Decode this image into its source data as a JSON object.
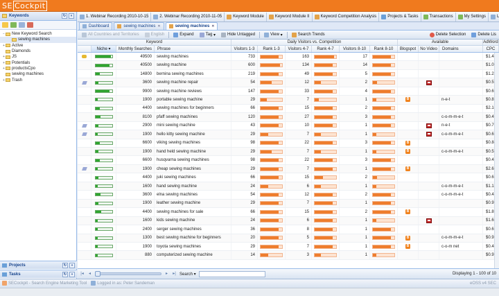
{
  "app": {
    "logo_text": "SE",
    "logo_box": "Cockpit",
    "accent": "#f07a1e"
  },
  "bookmarks": [
    "1. Webinar Recording 2010-10-15",
    "2. Webinar Recording 2010-11-05",
    "Keyword Module",
    "Keyword Module II",
    "Keyword Competition Analysis",
    "Projects & Tasks",
    "Transactions",
    "My Settings",
    "Logo"
  ],
  "left": {
    "title": "Keywords",
    "tree": [
      {
        "label": "New Keyword Search",
        "level": 0,
        "expander": "−"
      },
      {
        "label": "sewing machines",
        "level": 1,
        "selected": true
      },
      {
        "label": "Active",
        "level": 0,
        "expander": "+"
      },
      {
        "label": "Diamonds",
        "level": 0,
        "expander": ""
      },
      {
        "label": "JS",
        "level": 0,
        "expander": "+"
      },
      {
        "label": "Potentials",
        "level": 0,
        "expander": "+"
      },
      {
        "label": "productsCpo",
        "level": 0,
        "expander": "+"
      },
      {
        "label": "sewing machines",
        "level": 0,
        "expander": ""
      },
      {
        "label": "Trash",
        "level": 0,
        "expander": "+"
      }
    ],
    "projects_label": "Projects",
    "tasks_label": "Tasks"
  },
  "tabs": [
    {
      "label": "Dashboard",
      "active": false
    },
    {
      "label": "sewing machines",
      "active": false
    },
    {
      "label": "sewing machines",
      "active": true
    }
  ],
  "toolbar": {
    "all_countries": "All Countries and Territories",
    "english": "English",
    "expand": "Expand",
    "tag": "Tag",
    "hide_untagged": "Hide Untagged",
    "view": "View",
    "search_trends": "Search Trends",
    "delete_selection": "Delete Selection",
    "delete_list": "Delete Lis"
  },
  "headers": {
    "group_keyword": "Keyword",
    "group_daily": "Daily Visitors vs. Competition",
    "group_available": "Available",
    "group_adword": "AdWord",
    "niche": "Niche",
    "monthly": "Monthly Searches",
    "phrase": "Phrase",
    "v13": "Visitors 1-3",
    "r13": "Rank 1-3",
    "v47": "Visitors 4-7",
    "r47": "Rank 4-7",
    "v810": "Visitors 8-10",
    "r810": "Rank 8-10",
    "blogspot": "Blogspot",
    "novideo": "No Video",
    "domains": "Domains",
    "cpc": "CPC"
  },
  "rows": [
    {
      "icon": "key",
      "niche": 0.95,
      "searches": "49500",
      "phrase": "sewing machines",
      "v13": "733",
      "r13": 0.85,
      "v47": "163",
      "r47": 0.9,
      "v810": "17",
      "r810": 0.85,
      "blog": false,
      "video": false,
      "domain": "",
      "cpc": "$1.48"
    },
    {
      "icon": "",
      "niche": 0.85,
      "searches": "40500",
      "phrase": "sewing machine",
      "v13": "600",
      "r13": 0.9,
      "v47": "134",
      "r47": 0.85,
      "v810": "14",
      "r810": 0.85,
      "blog": false,
      "video": false,
      "domain": "",
      "cpc": "$1.06"
    },
    {
      "icon": "",
      "niche": 0.25,
      "searches": "14800",
      "phrase": "bernina sewing machines",
      "v13": "219",
      "r13": 0.85,
      "v47": "49",
      "r47": 0.85,
      "v810": "5",
      "r810": 0.85,
      "blog": false,
      "video": false,
      "domain": "",
      "cpc": "$1.22"
    },
    {
      "icon": "tag",
      "niche": 0.2,
      "searches": "3600",
      "phrase": "sewing machine repair",
      "v13": "54",
      "r13": 0.5,
      "v47": "12",
      "r47": 0.3,
      "v810": "2",
      "r810": 0.2,
      "blog": false,
      "video": true,
      "domain": "",
      "cpc": "$0.57"
    },
    {
      "icon": "",
      "niche": 0.85,
      "searches": "9900",
      "phrase": "sewing machine reviews",
      "v13": "147",
      "r13": 0.85,
      "v47": "33",
      "r47": 0.85,
      "v810": "4",
      "r810": 0.85,
      "blog": false,
      "video": false,
      "domain": "",
      "cpc": "$0.67"
    },
    {
      "icon": "",
      "niche": 0.15,
      "searches": "1900",
      "phrase": "portable sewing machine",
      "v13": "29",
      "r13": 0.3,
      "v47": "7",
      "r47": 0.2,
      "v810": "1",
      "r810": 0.15,
      "blog": true,
      "video": false,
      "domain": "n-e-t",
      "cpc": "$0.81"
    },
    {
      "icon": "",
      "niche": 0.25,
      "searches": "4400",
      "phrase": "sewing machines for beginners",
      "v13": "66",
      "r13": 0.85,
      "v47": "15",
      "r47": 0.85,
      "v810": "2",
      "r810": 0.85,
      "blog": false,
      "video": false,
      "domain": "",
      "cpc": "$2.10"
    },
    {
      "icon": "",
      "niche": 0.3,
      "searches": "8100",
      "phrase": "pfaff sewing machines",
      "v13": "120",
      "r13": 0.85,
      "v47": "27",
      "r47": 0.85,
      "v810": "3",
      "r810": 0.85,
      "blog": false,
      "video": false,
      "domain": "c-o-m-m-e-t",
      "cpc": "$0.49"
    },
    {
      "icon": "tag",
      "niche": 0.2,
      "searches": "2900",
      "phrase": "mini sewing machine",
      "v13": "43",
      "r13": 0.85,
      "v47": "10",
      "r47": 0.85,
      "v810": "1",
      "r810": 0.85,
      "blog": false,
      "video": true,
      "domain": "n-e-t",
      "cpc": "$0.70"
    },
    {
      "icon": "tag",
      "niche": 0.15,
      "searches": "1900",
      "phrase": "hello kitty sewing machine",
      "v13": "29",
      "r13": 0.35,
      "v47": "7",
      "r47": 0.3,
      "v810": "1",
      "r810": 0.15,
      "blog": false,
      "video": true,
      "domain": "c-o-m-m-e-t",
      "cpc": "$0.67"
    },
    {
      "icon": "",
      "niche": 0.25,
      "searches": "6600",
      "phrase": "viking sewing machines",
      "v13": "98",
      "r13": 0.85,
      "v47": "22",
      "r47": 0.85,
      "v810": "3",
      "r810": 0.85,
      "blog": true,
      "video": false,
      "domain": "",
      "cpc": "$0.84"
    },
    {
      "icon": "",
      "niche": 0.2,
      "searches": "1900",
      "phrase": "hand held sewing machine",
      "v13": "29",
      "r13": 0.5,
      "v47": "7",
      "r47": 0.3,
      "v810": "1",
      "r810": 0.15,
      "blog": true,
      "video": false,
      "domain": "c-o-m-m-e-t",
      "cpc": "$0.53"
    },
    {
      "icon": "",
      "niche": 0.25,
      "searches": "6600",
      "phrase": "husqvarna sewing machines",
      "v13": "98",
      "r13": 0.85,
      "v47": "22",
      "r47": 0.85,
      "v810": "3",
      "r810": 0.85,
      "blog": false,
      "video": false,
      "domain": "",
      "cpc": "$0.45"
    },
    {
      "icon": "tag",
      "niche": 0.15,
      "searches": "1900",
      "phrase": "cheap sewing machines",
      "v13": "29",
      "r13": 0.85,
      "v47": "7",
      "r47": 0.85,
      "v810": "1",
      "r810": 0.85,
      "blog": true,
      "video": false,
      "domain": "",
      "cpc": "$2.62"
    },
    {
      "icon": "",
      "niche": 0.2,
      "searches": "4400",
      "phrase": "juki sewing machines",
      "v13": "66",
      "r13": 0.85,
      "v47": "15",
      "r47": 0.4,
      "v810": "2",
      "r810": 0.2,
      "blog": false,
      "video": false,
      "domain": "",
      "cpc": "$0.67"
    },
    {
      "icon": "",
      "niche": 0.15,
      "searches": "1600",
      "phrase": "hand sewing machine",
      "v13": "24",
      "r13": 0.35,
      "v47": "6",
      "r47": 0.3,
      "v810": "1",
      "r810": 0.15,
      "blog": false,
      "video": false,
      "domain": "c-o-m-m-e-t",
      "cpc": "$1.18"
    },
    {
      "icon": "",
      "niche": 0.3,
      "searches": "3600",
      "phrase": "elna sewing machines",
      "v13": "54",
      "r13": 0.85,
      "v47": "12",
      "r47": 0.85,
      "v810": "2",
      "r810": 0.85,
      "blog": false,
      "video": false,
      "domain": "c-o-m-m-e-t",
      "cpc": "$0.43"
    },
    {
      "icon": "",
      "niche": 0.2,
      "searches": "1900",
      "phrase": "leather sewing machine",
      "v13": "29",
      "r13": 0.85,
      "v47": "7",
      "r47": 0.85,
      "v810": "1",
      "r810": 0.85,
      "blog": false,
      "video": false,
      "domain": "",
      "cpc": "$0.97"
    },
    {
      "icon": "",
      "niche": 0.35,
      "searches": "4400",
      "phrase": "sewing machines for sale",
      "v13": "66",
      "r13": 0.85,
      "v47": "15",
      "r47": 0.85,
      "v810": "2",
      "r810": 0.85,
      "blog": true,
      "video": false,
      "domain": "",
      "cpc": "$1.89"
    },
    {
      "icon": "",
      "niche": 0.15,
      "searches": "1600",
      "phrase": "kids sewing machine",
      "v13": "24",
      "r13": 0.85,
      "v47": "6",
      "r47": 0.85,
      "v810": "1",
      "r810": 0.15,
      "blog": false,
      "video": true,
      "domain": "",
      "cpc": "$1.65"
    },
    {
      "icon": "",
      "niche": 0.15,
      "searches": "2400",
      "phrase": "serger sewing machines",
      "v13": "36",
      "r13": 0.85,
      "v47": "8",
      "r47": 0.85,
      "v810": "1",
      "r810": 0.85,
      "blog": false,
      "video": false,
      "domain": "",
      "cpc": "$0.61"
    },
    {
      "icon": "",
      "niche": 0.15,
      "searches": "1300",
      "phrase": "best sewing machine for beginners",
      "v13": "20",
      "r13": 0.85,
      "v47": "5",
      "r47": 0.85,
      "v810": "1",
      "r810": 0.85,
      "blog": true,
      "video": false,
      "domain": "c-o-m-m-e-t",
      "cpc": "$0.93"
    },
    {
      "icon": "",
      "niche": 0.15,
      "searches": "1900",
      "phrase": "toyota sewing machines",
      "v13": "29",
      "r13": 0.85,
      "v47": "7",
      "r47": 0.85,
      "v810": "1",
      "r810": 0.85,
      "blog": true,
      "video": false,
      "domain": "c-o-m net",
      "cpc": "$0.40"
    },
    {
      "icon": "",
      "niche": 0.15,
      "searches": "880",
      "phrase": "computerized sewing machine",
      "v13": "14",
      "r13": 0.35,
      "v47": "3",
      "r47": 0.3,
      "v810": "1",
      "r810": 0.15,
      "blog": false,
      "video": false,
      "domain": "",
      "cpc": "$0.97"
    }
  ],
  "paging": {
    "search_label": "Search",
    "display_text": "Displaying 1 - 100 of 10"
  },
  "status": {
    "app_text": "SECockpit - Search Engine Marketing Tool",
    "user_text": "Logged in as: Peter Sandeman",
    "right_text": "eOSS v4 SEC"
  },
  "colors": {
    "orange_bar": "#ee7d2d",
    "green_bar": "#2fa52f",
    "header_blue": "#15428b"
  }
}
